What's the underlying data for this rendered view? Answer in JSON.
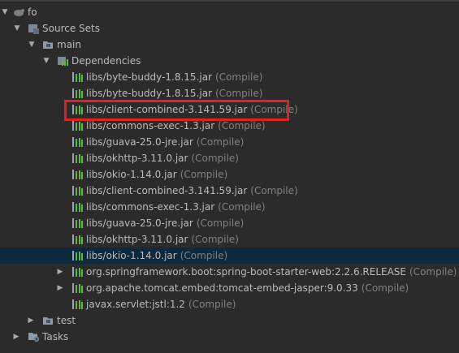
{
  "colors": {
    "background": "#2b2b2b",
    "selected_row": "#0d293e",
    "highlight_box": "#e0211e",
    "text": "#bbbbbb",
    "scope_text": "#808080"
  },
  "tree": {
    "root": {
      "label": "fo",
      "icon": "module-icon",
      "toggle": "expanded"
    },
    "source_sets": {
      "label": "Source Sets",
      "icon": "source-sets-icon",
      "toggle": "expanded"
    },
    "main": {
      "label": "main",
      "icon": "folder-icon",
      "toggle": "expanded"
    },
    "dependencies": {
      "label": "Dependencies",
      "icon": "dependencies-icon",
      "toggle": "expanded"
    },
    "items": [
      {
        "name": "libs/byte-buddy-1.8.15.jar",
        "scope": "(Compile)",
        "icon": "library-icon"
      },
      {
        "name": "libs/byte-buddy-1.8.15.jar",
        "scope": "(Compile)",
        "icon": "library-icon"
      },
      {
        "name": "libs/client-combined-3.141.59.jar",
        "scope": "(Compile)",
        "icon": "library-icon"
      },
      {
        "name": "libs/commons-exec-1.3.jar",
        "scope": "(Compile)",
        "icon": "library-icon"
      },
      {
        "name": "libs/guava-25.0-jre.jar",
        "scope": "(Compile)",
        "icon": "library-icon"
      },
      {
        "name": "libs/okhttp-3.11.0.jar",
        "scope": "(Compile)",
        "icon": "library-icon"
      },
      {
        "name": "libs/okio-1.14.0.jar",
        "scope": "(Compile)",
        "icon": "library-icon"
      },
      {
        "name": "libs/client-combined-3.141.59.jar",
        "scope": "(Compile)",
        "icon": "library-icon"
      },
      {
        "name": "libs/commons-exec-1.3.jar",
        "scope": "(Compile)",
        "icon": "library-icon"
      },
      {
        "name": "libs/guava-25.0-jre.jar",
        "scope": "(Compile)",
        "icon": "library-icon"
      },
      {
        "name": "libs/okhttp-3.11.0.jar",
        "scope": "(Compile)",
        "icon": "library-icon"
      },
      {
        "name": "libs/okio-1.14.0.jar",
        "scope": "(Compile)",
        "icon": "library-icon",
        "selected": true
      },
      {
        "name": "org.springframework.boot:spring-boot-starter-web:2.2.6.RELEASE",
        "scope": "(Compile)",
        "icon": "library-icon",
        "toggle": "collapsed"
      },
      {
        "name": "org.apache.tomcat.embed:tomcat-embed-jasper:9.0.33",
        "scope": "(Compile)",
        "icon": "library-icon",
        "toggle": "collapsed"
      },
      {
        "name": "javax.servlet:jstl:1.2",
        "scope": "(Compile)",
        "icon": "library-icon"
      }
    ],
    "test": {
      "label": "test",
      "icon": "folder-icon",
      "toggle": "collapsed"
    },
    "tasks": {
      "label": "Tasks",
      "icon": "tasks-icon",
      "toggle": "collapsed"
    }
  }
}
